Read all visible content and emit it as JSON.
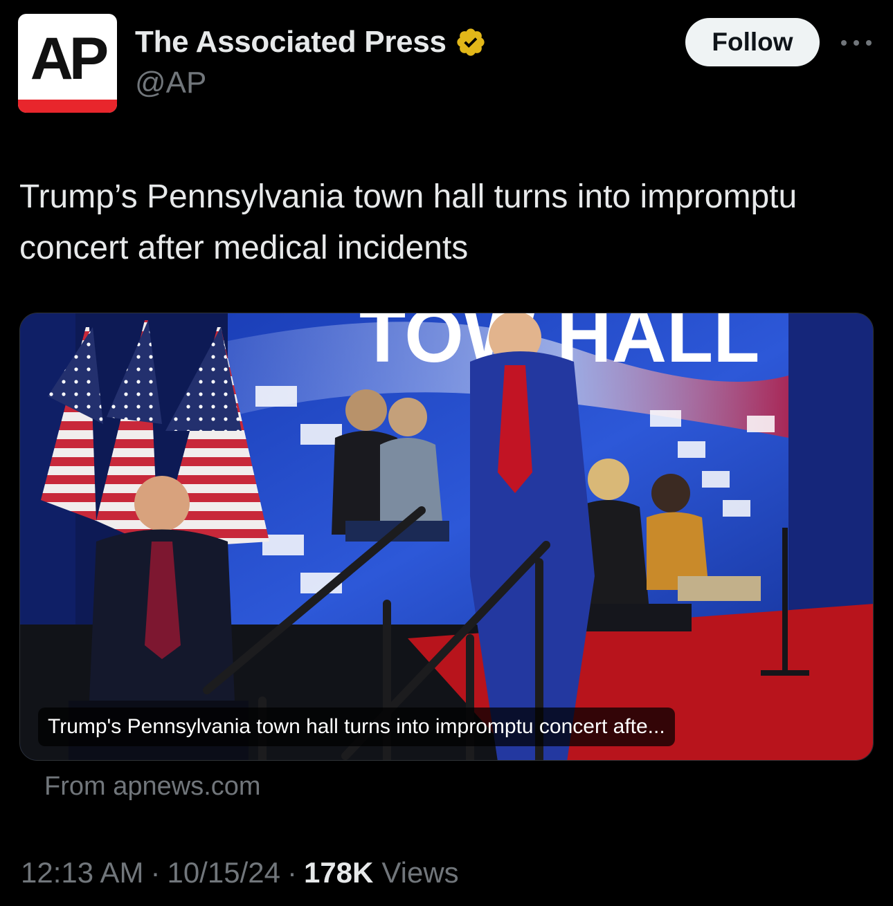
{
  "author": {
    "avatar_text": "AP",
    "name": "The Associated Press",
    "handle": "@AP",
    "verified": true
  },
  "actions": {
    "follow_label": "Follow",
    "more_icon": "more-horizontal-icon"
  },
  "tweet": {
    "text": "Trump’s Pennsylvania town hall turns into impromptu concert after medical incidents"
  },
  "card": {
    "photo_text": "TOW HALL",
    "caption": "Trump's Pennsylvania town hall turns into impromptu concert afte...",
    "source": "From apnews.com"
  },
  "meta": {
    "time": "12:13 AM",
    "date": "10/15/24",
    "views_count": "178K",
    "views_label": "Views"
  },
  "colors": {
    "background": "#000000",
    "text": "#e7e9ea",
    "muted": "#71767b",
    "verified_gold": "#e2b719",
    "ap_red": "#e8262c"
  }
}
